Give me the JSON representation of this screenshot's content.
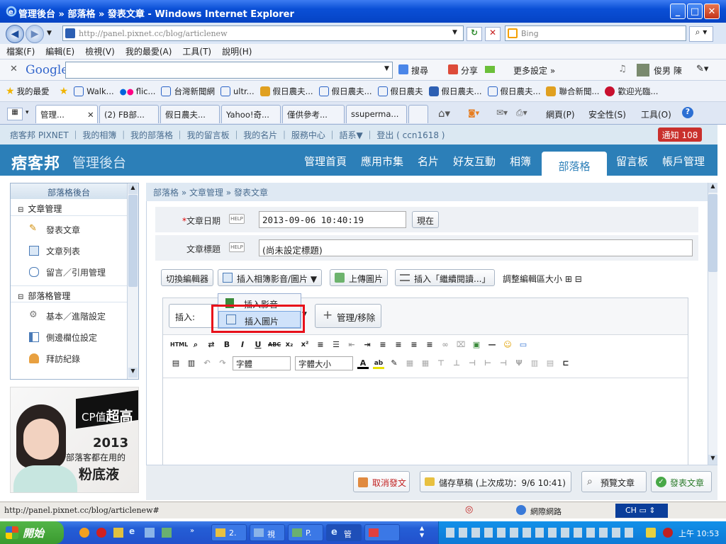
{
  "window": {
    "title": "管理後台 » 部落格 » 發表文章 - Windows Internet Explorer"
  },
  "addressbar": {
    "url": "http://panel.pixnet.cc/blog/articlenew",
    "search_placeholder": "Bing"
  },
  "menu": [
    "檔案(F)",
    "編輯(E)",
    "檢視(V)",
    "我的最愛(A)",
    "工具(T)",
    "說明(H)"
  ],
  "googlebar": {
    "logo": "Google",
    "search": "搜尋",
    "share": "分享",
    "more": "更多設定 »",
    "user": "俊男 陳"
  },
  "favorites": {
    "label": "我的最愛",
    "items": [
      "Walk...",
      "flic...",
      "台灣新聞網",
      "ultr...",
      "假日農夫...",
      "假日農夫...",
      "假日農夫",
      "假日農夫...",
      "假日農夫...",
      "聯合新聞...",
      "歡迎光臨..."
    ]
  },
  "tabs": [
    {
      "label": "管理..."
    },
    {
      "label": "(2) FB部..."
    },
    {
      "label": "假日農夫..."
    },
    {
      "label": "Yahoo!奇..."
    },
    {
      "label": "僅供參考..."
    },
    {
      "label": "ssuperma..."
    }
  ],
  "ie_commands": [
    "網頁(P)",
    "安全性(S)",
    "工具(O)"
  ],
  "toplinks": "痞客邦 PIXNET ｜ 我的相簿 ｜ 我的部落格 ｜ 我的留言板 ｜ 我的名片 ｜ 服務中心 ｜ 語系▼ ｜ 登出 ( ccn1618 )",
  "notify": "通知 108",
  "header": {
    "logo": "痞客邦",
    "title": "管理後台",
    "nav": [
      "管理首頁",
      "應用市集",
      "名片",
      "好友互動",
      "相簿",
      "部落格",
      "留言板",
      "帳戶管理"
    ],
    "active": "部落格"
  },
  "sidebar": {
    "title": "部落格後台",
    "sections": [
      {
        "label": "文章管理",
        "items": [
          "發表文章",
          "文章列表",
          "留言／引用管理"
        ]
      },
      {
        "label": "部落格管理",
        "items": [
          "基本／進階設定",
          "側邊欄位設定",
          "拜訪紀錄"
        ]
      }
    ]
  },
  "ad": {
    "line1": "CP值",
    "line1b": "超高",
    "year": "2013",
    "line2": "部落客都在用的",
    "line3": "粉底液"
  },
  "breadcrumb": "部落格 » 文章管理 » 發表文章",
  "form": {
    "date_label": "文章日期",
    "help": "HELP",
    "date_value": "2013-09-06 10:40:19",
    "now_btn": "現在",
    "title_label": "文章標題",
    "title_value": "(尚未設定標題)"
  },
  "editor_buttons": {
    "switch": "切換編輯器",
    "insert_media": "插入相簿影音/圖片",
    "upload": "上傳圖片",
    "insert_more": "插入「繼續閱讀...」",
    "resize": "調整編輯區大小"
  },
  "insertbar": {
    "label": "插入:",
    "manage": "管理/移除"
  },
  "popup": {
    "items": [
      "插入影音",
      "插入圖片"
    ]
  },
  "toolbar": {
    "font": "字體",
    "size": "字體大小"
  },
  "bottom": {
    "cancel": "取消發文",
    "save": "儲存草稿 (上次成功：9/6 10:41)",
    "preview": "預覽文章",
    "publish": "發表文章"
  },
  "statusbar": {
    "url": "http://panel.pixnet.cc/blog/articlenew#",
    "zone": "網際網路"
  },
  "taskbar": {
    "start": "開始",
    "tasks": [
      "2.",
      "視",
      "P.",
      "管"
    ],
    "clock": "上午 10:53",
    "ime": "CH"
  }
}
